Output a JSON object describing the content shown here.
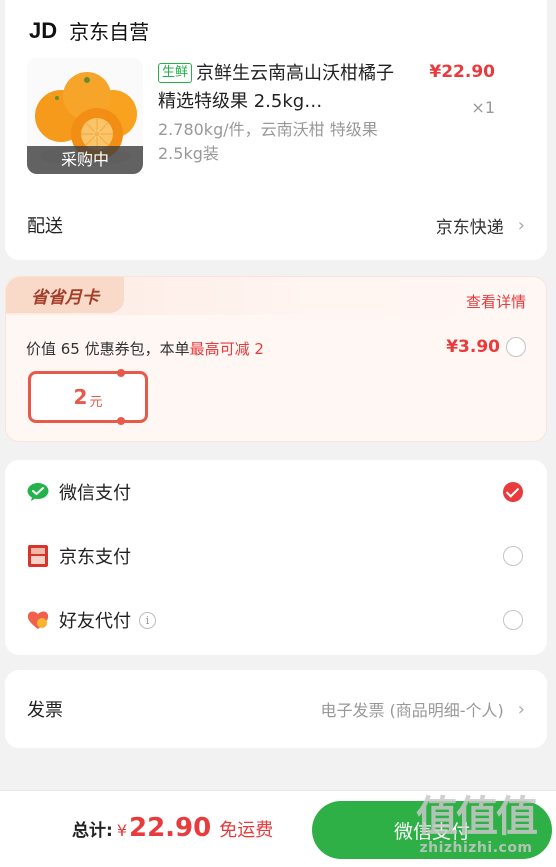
{
  "shop": {
    "logo": "JD",
    "name": "京东自营"
  },
  "product": {
    "tag": "生鲜",
    "title": "京鲜生云南高山沃柑橘子 精选特级果 2.5kg…",
    "spec": "2.780kg/件，云南沃柑 特级果 2.5kg装",
    "price": "¥22.90",
    "qty": "×1",
    "status": "采购中",
    "image_icon": "tangerine-image"
  },
  "delivery": {
    "label": "配送",
    "value": "京东快递"
  },
  "saving_card": {
    "badge": "省省月卡",
    "detail_link": "查看详情",
    "desc_prefix": "价值 65 优惠券包，本单",
    "desc_highlight": "最高可减 2",
    "price": "¥3.90",
    "selected": false,
    "coupon_amount": "2",
    "coupon_unit": "元"
  },
  "payment": {
    "methods": [
      {
        "label": "微信支付",
        "icon": "wechat-pay-icon",
        "selected": true
      },
      {
        "label": "京东支付",
        "icon": "jd-pay-icon",
        "selected": false
      },
      {
        "label": "好友代付",
        "icon": "friend-pay-icon",
        "selected": false,
        "info": true
      }
    ]
  },
  "invoice": {
    "label": "发票",
    "value": "电子发票 (商品明细-个人)"
  },
  "footer": {
    "total_label": "总计:",
    "currency": "¥",
    "total": "22.90",
    "shipping": "免运费",
    "pay_button": "微信支付"
  },
  "watermark": {
    "cn": "值值值",
    "en": "zhizhizhi.com"
  },
  "colors": {
    "accent_red": "#e93b3d",
    "wechat_green": "#2fb046",
    "fresh_tag_green": "#24b24a"
  }
}
